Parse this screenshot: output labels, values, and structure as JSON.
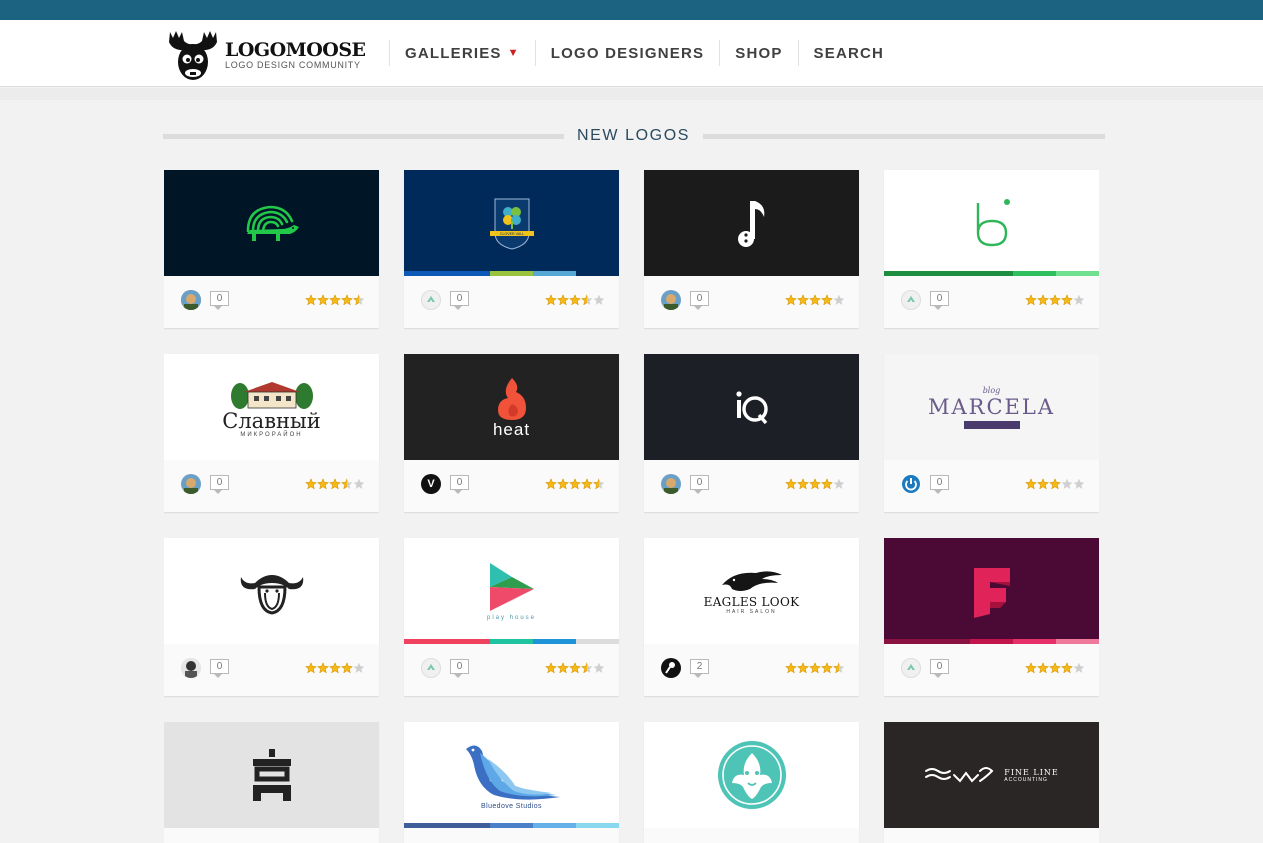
{
  "site": {
    "name": "LOGOMOOSE",
    "tagline": "LOGO DESIGN COMMUNITY"
  },
  "nav": [
    {
      "label": "GALLERIES",
      "caret": "▼"
    },
    {
      "label": "LOGO DESIGNERS"
    },
    {
      "label": "SHOP"
    },
    {
      "label": "SEARCH"
    }
  ],
  "section": {
    "title": "NEW LOGOS"
  },
  "colors": {
    "topbar": "#1c6381",
    "accent_red": "#cc1f1f",
    "star": "#f5b816"
  },
  "logos": [
    {
      "comments": "0",
      "rating": 4.5,
      "bg": "#001526",
      "art": "hedgehog-icon",
      "avatar": "photo-avatar"
    },
    {
      "comments": "0",
      "rating": 3.5,
      "bg": "#002a5a",
      "art": "clover-crest-icon",
      "avatar": "up-arrow-avatar",
      "text": "CLOVER VALL"
    },
    {
      "comments": "0",
      "rating": 4,
      "bg": "#1b1b1b",
      "art": "music-note-icon",
      "avatar": "photo-avatar"
    },
    {
      "comments": "0",
      "rating": 4,
      "bg": "#ffffff",
      "art": "letter-b-icon",
      "avatar": "up-arrow-avatar"
    },
    {
      "comments": "0",
      "rating": 3.5,
      "bg": "#ffffff",
      "art": "house-illustration-icon",
      "avatar": "photo-avatar",
      "text": "Славный",
      "sub": "МИКРОРАЙОН"
    },
    {
      "comments": "0",
      "rating": 4.5,
      "bg": "#222222",
      "art": "flame-icon",
      "avatar": "v-avatar",
      "avatar_letter": "V",
      "text": "heat"
    },
    {
      "comments": "0",
      "rating": 4,
      "bg": "#1c2026",
      "art": "iq-icon",
      "avatar": "photo-avatar"
    },
    {
      "comments": "0",
      "rating": 3,
      "bg": "#f5f5f5",
      "art": "marcela-wordmark",
      "avatar": "power-avatar",
      "text": "MARCELA",
      "sub": "blog"
    },
    {
      "comments": "0",
      "rating": 4,
      "bg": "#ffffff",
      "art": "buffalo-icon",
      "avatar": "bw-photo-avatar"
    },
    {
      "comments": "0",
      "rating": 3.5,
      "bg": "#ffffff",
      "art": "play-triangle-icon",
      "avatar": "up-arrow-avatar",
      "text": "play house"
    },
    {
      "comments": "2",
      "rating": 4.5,
      "bg": "#ffffff",
      "art": "eagle-icon",
      "avatar": "mic-avatar",
      "text": "EAGLES LOOK",
      "sub": "HAIR SALON"
    },
    {
      "comments": "0",
      "rating": 4,
      "bg": "#4a0a35",
      "art": "letter-f-icon",
      "avatar": "up-arrow-avatar"
    },
    {
      "comments": "",
      "rating": 0,
      "bg": "#e3e3e3",
      "art": "tower-icon",
      "avatar": ""
    },
    {
      "comments": "",
      "rating": 0,
      "bg": "#ffffff",
      "art": "bird-icon",
      "avatar": "",
      "text": "Bluedove Studios"
    },
    {
      "comments": "",
      "rating": 0,
      "bg": "#ffffff",
      "art": "ornament-medallion-icon",
      "avatar": ""
    },
    {
      "comments": "",
      "rating": 0,
      "bg": "#2b2626",
      "art": "fine-line-wordmark",
      "avatar": "",
      "text": "FINE LINE",
      "sub": "ACCOUNTING"
    }
  ]
}
